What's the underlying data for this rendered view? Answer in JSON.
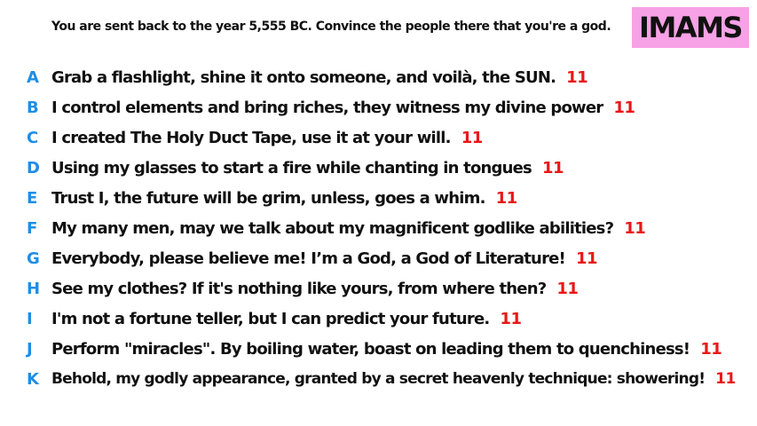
{
  "prompt": "You are sent back to the year 5,555 BC. Convince the people there that you're a god.",
  "badge": {
    "label": "IMAMS",
    "bg_color": "#f7a1e6",
    "text_color": "#111111"
  },
  "colors": {
    "letter": "#1e8ee6",
    "score": "#e81818",
    "text": "#111111"
  },
  "answers": [
    {
      "letter": "A",
      "text": "Grab a flashlight, shine it onto someone, and voilà, the SUN.",
      "score": "11"
    },
    {
      "letter": "B",
      "text": "I control elements and bring riches, they witness my divine power",
      "score": "11"
    },
    {
      "letter": "C",
      "text": "I created The Holy Duct Tape, use it at your will.",
      "score": "11"
    },
    {
      "letter": "D",
      "text": "Using my glasses to start a fire while chanting in tongues",
      "score": "11"
    },
    {
      "letter": "E",
      "text": "Trust I, the future will be grim, unless, goes a whim.",
      "score": "11"
    },
    {
      "letter": "F",
      "text": "My many men, may we talk about my magnificent godlike abilities?",
      "score": "11"
    },
    {
      "letter": "G",
      "text": "Everybody, please believe me! I’m a God, a God of Literature!",
      "score": "11"
    },
    {
      "letter": "H",
      "text": "See my clothes? If it's nothing like yours, from where then?",
      "score": "11"
    },
    {
      "letter": "I",
      "text": "I'm not a fortune teller, but I can predict your future.",
      "score": "11"
    },
    {
      "letter": "J",
      "text": "Perform \"miracles\". By boiling water, boast on leading them to quenchiness!",
      "score": "11"
    },
    {
      "letter": "K",
      "text": "Behold, my godly appearance, granted by a secret heavenly technique: showering!",
      "score": "11"
    }
  ]
}
